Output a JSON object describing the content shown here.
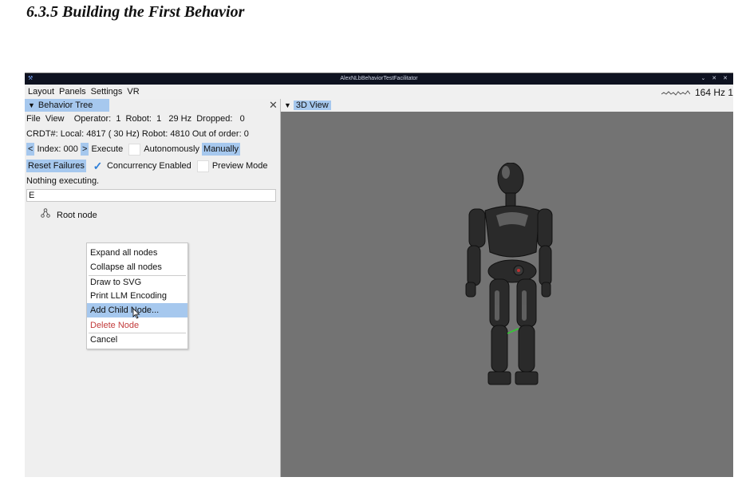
{
  "section_heading": "6.3.5   Building the First Behavior",
  "window": {
    "title": "AlexNLbBehaviorTestFacilitator",
    "controls": "⌄ ✕ ✕"
  },
  "menubar": {
    "items": [
      "Layout",
      "Panels",
      "Settings",
      "VR"
    ],
    "rate_text": "164 Hz 1"
  },
  "behavior_tree_panel": {
    "tab_label": "Behavior Tree",
    "close_glyph": "✕",
    "menu_file": "File",
    "menu_view": "View",
    "status_line": "Operator:  1  Robot:  1   29 Hz  Dropped:   0",
    "crdt_line": "CRDT#: Local: 4817 ( 30 Hz)  Robot: 4810  Out of order: 0",
    "prev_button": "<",
    "index_text": "Index: 000",
    "next_button": ">",
    "execute_label": "Execute",
    "autonomously_label": "Autonomously",
    "manually_label": "Manually",
    "reset_failures_label": "Reset Failures",
    "concurrency_label": "Concurrency Enabled",
    "concurrency_checked": true,
    "preview_label": "Preview Mode",
    "nothing_executing": "Nothing executing.",
    "search_value": "E",
    "root_node_label": "Root node",
    "context_menu": {
      "items": [
        "Expand all nodes",
        "Collapse all nodes",
        "Draw to SVG",
        "Print LLM Encoding",
        "Add Child Node...",
        "Delete Node",
        "Cancel"
      ],
      "highlighted": "Add Child Node...",
      "danger": "Delete Node"
    }
  },
  "view_panel": {
    "tab_label": "3D View",
    "background_color": "#737373"
  },
  "colors": {
    "accent": "#a6c8ee",
    "danger": "#c23b3b",
    "titlebar": "#0e1220"
  }
}
